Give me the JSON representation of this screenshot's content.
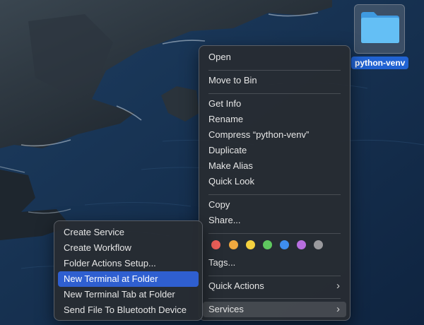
{
  "desktop": {
    "folder": {
      "name": "python-venv",
      "icon": "folder-icon"
    }
  },
  "context_menu": {
    "items": [
      {
        "label": "Open"
      },
      {
        "label": "Move to Bin"
      },
      {
        "label": "Get Info"
      },
      {
        "label": "Rename"
      },
      {
        "label": "Compress “python-venv”"
      },
      {
        "label": "Duplicate"
      },
      {
        "label": "Make Alias"
      },
      {
        "label": "Quick Look"
      },
      {
        "label": "Copy"
      },
      {
        "label": "Share..."
      },
      {
        "label": "Tags..."
      },
      {
        "label": "Quick Actions"
      },
      {
        "label": "Services"
      }
    ],
    "tag_colors": [
      {
        "name": "red",
        "color": "#ec5f59"
      },
      {
        "name": "orange",
        "color": "#f0a83f"
      },
      {
        "name": "yellow",
        "color": "#f5d13f"
      },
      {
        "name": "green",
        "color": "#5fc95f"
      },
      {
        "name": "blue",
        "color": "#3e8ef0"
      },
      {
        "name": "purple",
        "color": "#b86fe0"
      },
      {
        "name": "gray",
        "color": "#9a9a9e"
      }
    ],
    "submenu_icon": "chevron-right-icon"
  },
  "services_submenu": {
    "items": [
      {
        "label": "Create Service"
      },
      {
        "label": "Create Workflow"
      },
      {
        "label": "Folder Actions Setup..."
      },
      {
        "label": "New Terminal at Folder"
      },
      {
        "label": "New Terminal Tab at Folder"
      },
      {
        "label": "Send File To Bluetooth Device"
      }
    ],
    "highlighted_index": 3
  },
  "colors": {
    "highlight": "#2f5fd0",
    "selection_label": "#2163d3",
    "folder": "#5fb8f2"
  }
}
